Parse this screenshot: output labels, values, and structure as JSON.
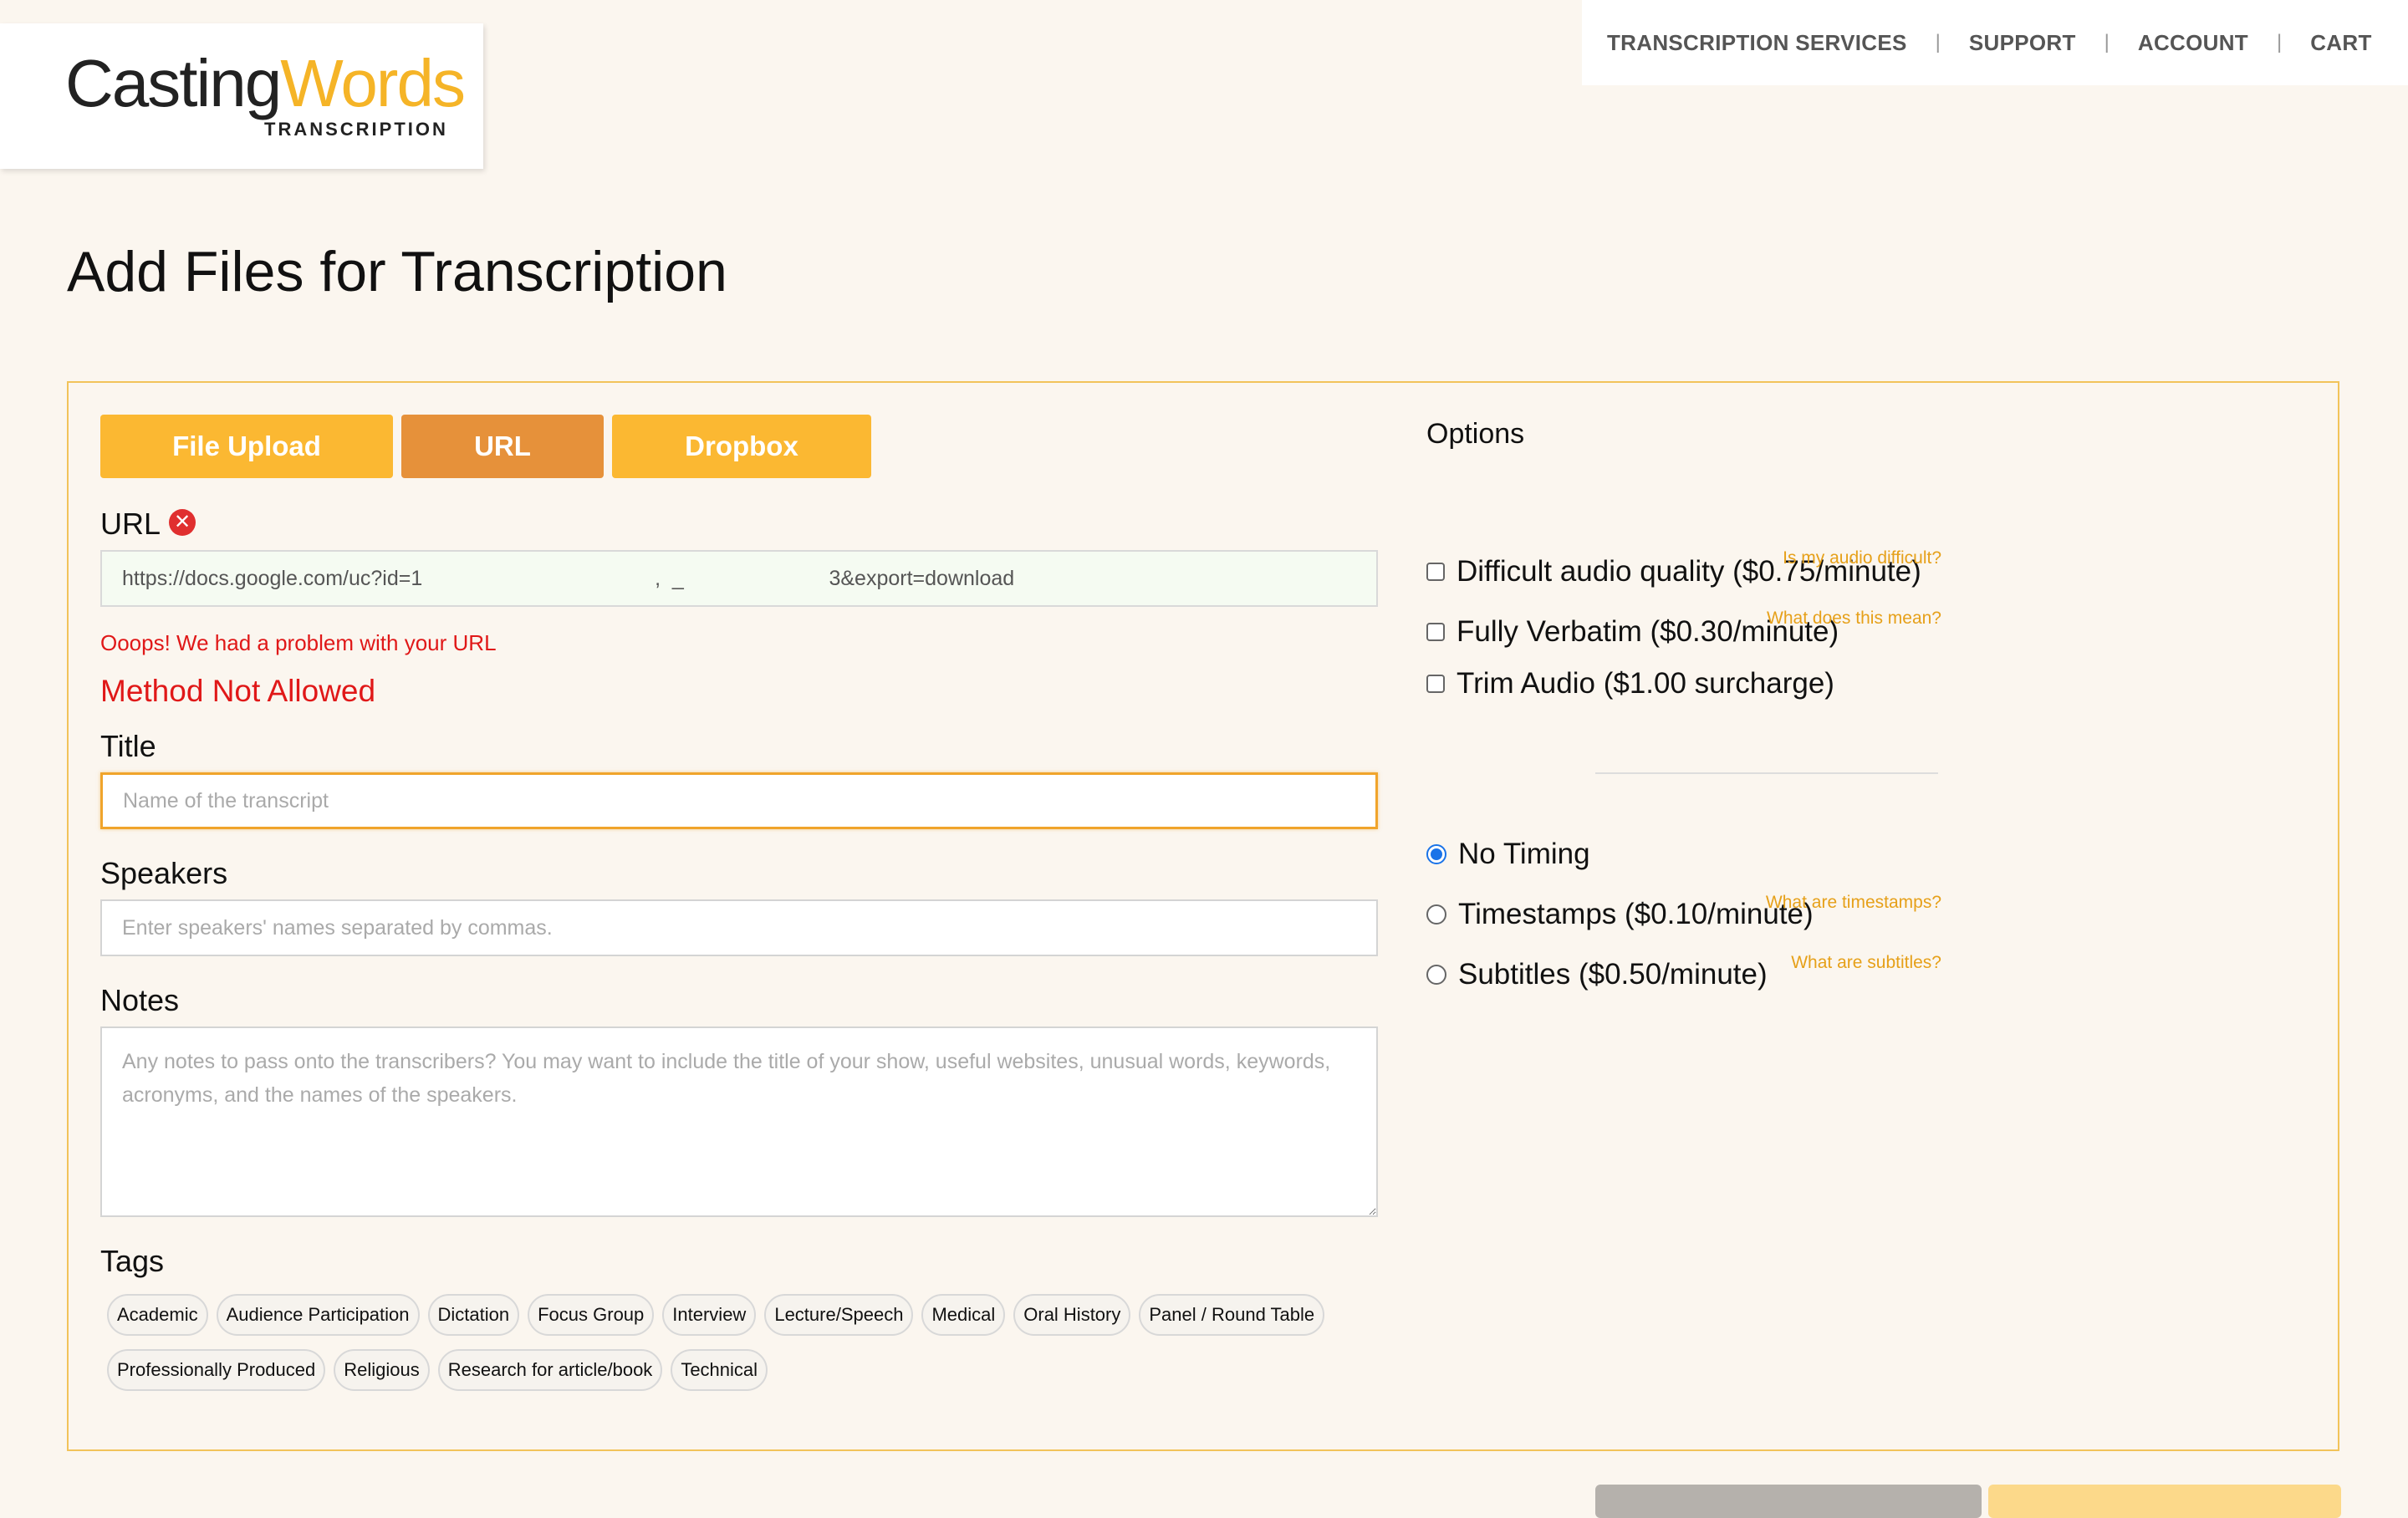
{
  "logo": {
    "word_a": "Casting",
    "word_b": "Words",
    "sub": "TRANSCRIPTION"
  },
  "nav": [
    "TRANSCRIPTION SERVICES",
    "SUPPORT",
    "ACCOUNT",
    "CART"
  ],
  "page_title": "Add Files for Transcription",
  "tabs": {
    "file_upload": "File Upload",
    "url": "URL",
    "dropbox": "Dropbox",
    "active": "URL"
  },
  "url_label": "URL",
  "url_value": "https://docs.google.com/uc?id=1                                        ,  _                         3&export=download",
  "error_small": "Ooops! We had a problem with your URL",
  "error_big": "Method Not Allowed",
  "title_label": "Title",
  "title_placeholder": "Name of the transcript",
  "speakers_label": "Speakers",
  "speakers_placeholder": "Enter speakers' names separated by commas.",
  "notes_label": "Notes",
  "notes_placeholder": "Any notes to pass onto the transcribers? You may want to include the title of your show, useful websites, unusual words, keywords, acronyms, and the names of the speakers.",
  "tags_label": "Tags",
  "tags_row1": [
    "Academic",
    "Audience Participation",
    "Dictation",
    "Focus Group",
    "Interview",
    "Lecture/Speech",
    "Medical",
    "Oral History",
    "Panel / Round Table"
  ],
  "tags_row2": [
    "Professionally Produced",
    "Religious",
    "Research for article/book",
    "Technical"
  ],
  "options": {
    "title": "Options",
    "difficult": "Difficult audio quality ($0.75/minute)",
    "difficult_help": "Is my audio difficult?",
    "verbatim": "Fully Verbatim ($0.30/minute)",
    "verbatim_help": "What does this mean?",
    "trim": "Trim Audio ($1.00 surcharge)",
    "no_timing": "No Timing",
    "timestamps": "Timestamps ($0.10/minute)",
    "timestamps_help": "What are timestamps?",
    "subtitles": "Subtitles ($0.50/minute)",
    "subtitles_help": "What are subtitles?",
    "selected_timing": "No Timing"
  },
  "colors": {
    "accent": "#fbb832",
    "accent_active": "#e6913a",
    "error": "#e01818",
    "link": "#e6a019",
    "background": "#fbf6ef"
  }
}
